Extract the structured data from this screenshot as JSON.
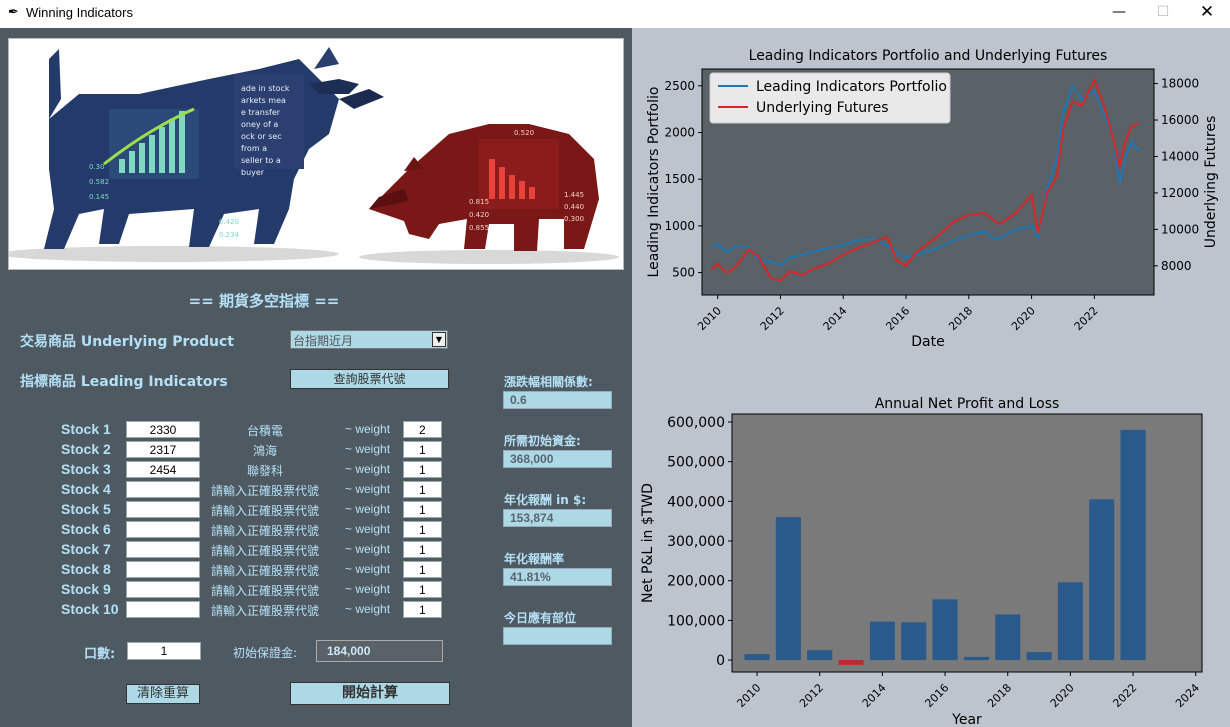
{
  "window": {
    "title": "Winning Indicators",
    "icon": "feather-icon"
  },
  "form": {
    "heading": "== 期貨多空指標 ==",
    "product_label": "交易商品 Underlying Product",
    "product_selected": "台指期近月",
    "indicators_label": "指標商品 Leading Indicators",
    "lookup_button": "查詢股票代號",
    "weight_label": "~ weight",
    "stocks": [
      {
        "label": "Stock 1",
        "code": "2330",
        "name": "台積電",
        "weight": "2"
      },
      {
        "label": "Stock 2",
        "code": "2317",
        "name": "鴻海",
        "weight": "1"
      },
      {
        "label": "Stock 3",
        "code": "2454",
        "name": "聯發科",
        "weight": "1"
      },
      {
        "label": "Stock 4",
        "code": "",
        "name": "請輸入正確股票代號",
        "weight": "1"
      },
      {
        "label": "Stock 5",
        "code": "",
        "name": "請輸入正確股票代號",
        "weight": "1"
      },
      {
        "label": "Stock 6",
        "code": "",
        "name": "請輸入正確股票代號",
        "weight": "1"
      },
      {
        "label": "Stock 7",
        "code": "",
        "name": "請輸入正確股票代號",
        "weight": "1"
      },
      {
        "label": "Stock 8",
        "code": "",
        "name": "請輸入正確股票代號",
        "weight": "1"
      },
      {
        "label": "Stock 9",
        "code": "",
        "name": "請輸入正確股票代號",
        "weight": "1"
      },
      {
        "label": "Stock 10",
        "code": "",
        "name": "請輸入正確股票代號",
        "weight": "1"
      }
    ],
    "contracts_label": "口數:",
    "contracts_value": "1",
    "margin_label": "初始保證金:",
    "margin_value": "184,000",
    "reset_button": "清除重算",
    "start_button": "開始計算"
  },
  "results": [
    {
      "label": "漲跌幅相關係數:",
      "value": "0.6"
    },
    {
      "label": "所需初始資金:",
      "value": "368,000"
    },
    {
      "label": "年化報酬 in $:",
      "value": "153,874"
    },
    {
      "label": "年化報酬率",
      "value": "41.81%"
    },
    {
      "label": "今日應有部位",
      "value": ""
    }
  ],
  "chart_data": [
    {
      "type": "line",
      "title": "Leading Indicators Portfolio and Underlying Futures",
      "xlabel": "Date",
      "ylabel": "Leading Indicators Portfolio",
      "y2label": "Underlying Futures",
      "xlim": [
        2009.5,
        2023.9
      ],
      "ylim": [
        260,
        2680
      ],
      "y2lim": [
        6400,
        18800
      ],
      "x_ticks": [
        "2010",
        "2012",
        "2014",
        "2016",
        "2018",
        "2020",
        "2022"
      ],
      "y_ticks": [
        500,
        1000,
        1500,
        2000,
        2500
      ],
      "y2_ticks": [
        8000,
        10000,
        12000,
        14000,
        16000,
        18000
      ],
      "legend": "top-left",
      "colors": {
        "series1": "#1f77b4",
        "series2": "#d62728",
        "plot_bg": "#5a6167"
      },
      "series": [
        {
          "name": "Leading Indicators Portfolio",
          "axis": "left",
          "x": [
            2009.8,
            2010.0,
            2010.3,
            2010.6,
            2011.0,
            2011.3,
            2011.7,
            2012.0,
            2012.3,
            2012.7,
            2013.0,
            2013.5,
            2014.0,
            2014.5,
            2015.0,
            2015.4,
            2015.7,
            2016.0,
            2016.3,
            2016.6,
            2017.0,
            2017.5,
            2018.0,
            2018.5,
            2018.8,
            2019.0,
            2019.5,
            2020.0,
            2020.2,
            2020.5,
            2020.8,
            2021.0,
            2021.3,
            2021.6,
            2022.0,
            2022.3,
            2022.6,
            2022.8,
            2023.0,
            2023.2,
            2023.4
          ],
          "values": [
            760,
            810,
            720,
            780,
            770,
            640,
            620,
            580,
            660,
            690,
            720,
            760,
            800,
            850,
            860,
            790,
            720,
            660,
            690,
            720,
            760,
            840,
            900,
            940,
            860,
            870,
            960,
            1000,
            880,
            1400,
            1700,
            2200,
            2500,
            2350,
            2450,
            2200,
            1950,
            1450,
            1750,
            1900,
            1800
          ]
        },
        {
          "name": "Underlying Futures",
          "axis": "right",
          "x": [
            2009.8,
            2010.0,
            2010.3,
            2010.6,
            2011.0,
            2011.3,
            2011.7,
            2012.0,
            2012.3,
            2012.7,
            2013.0,
            2013.5,
            2014.0,
            2014.5,
            2015.0,
            2015.4,
            2015.7,
            2016.0,
            2016.3,
            2016.6,
            2017.0,
            2017.5,
            2018.0,
            2018.5,
            2018.8,
            2019.0,
            2019.5,
            2020.0,
            2020.2,
            2020.5,
            2020.8,
            2021.0,
            2021.3,
            2021.6,
            2022.0,
            2022.3,
            2022.6,
            2022.8,
            2023.0,
            2023.2,
            2023.4
          ],
          "values": [
            7800,
            8100,
            7600,
            8000,
            8900,
            8500,
            7300,
            7200,
            7700,
            7500,
            7800,
            8100,
            8600,
            9000,
            9300,
            9600,
            8300,
            8000,
            8700,
            9100,
            9600,
            10400,
            10800,
            10900,
            10500,
            10300,
            10900,
            11900,
            9800,
            12000,
            12900,
            15500,
            17000,
            16800,
            18200,
            16800,
            15000,
            13400,
            14900,
            15700,
            15800
          ]
        }
      ]
    },
    {
      "type": "bar",
      "title": "Annual Net Profit and Loss",
      "xlabel": "Year",
      "ylabel": "Net P&L in $TWD",
      "xlim": [
        2009.2,
        2024.2
      ],
      "ylim": [
        -30000,
        620000
      ],
      "x_ticks": [
        "2010",
        "2012",
        "2014",
        "2016",
        "2018",
        "2020",
        "2022",
        "2024"
      ],
      "y_ticks": [
        "0",
        "100,000",
        "200,000",
        "300,000",
        "400,000",
        "500,000",
        "600,000"
      ],
      "colors": {
        "positive": "#2a5a8c",
        "negative": "#c0282d",
        "plot_bg": "#7a7a7a"
      },
      "categories": [
        2010,
        2011,
        2012,
        2013,
        2014,
        2015,
        2016,
        2017,
        2018,
        2019,
        2020,
        2021,
        2022
      ],
      "values": [
        15000,
        360000,
        25000,
        -12000,
        97000,
        95000,
        153000,
        8000,
        115000,
        20000,
        196000,
        405000,
        580000
      ]
    }
  ]
}
